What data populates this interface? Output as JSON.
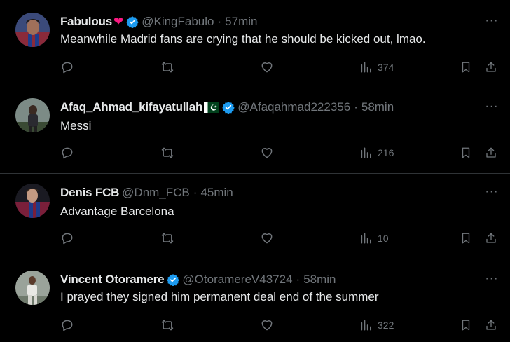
{
  "colors": {
    "background": "#000000",
    "text": "#e7e9ea",
    "muted": "#71767b",
    "verified": "#1d9bf0",
    "divider": "#2f3336"
  },
  "tweets": [
    {
      "name": "Fabulous",
      "name_suffix_icon": "red-heart-icon",
      "verified": true,
      "handle": "@KingFabulo",
      "time": "57min",
      "text": "Meanwhile Madrid fans are crying that he should be kicked out, lmao.",
      "views": "374"
    },
    {
      "name": "Afaq_Ahmad_kifayatullah",
      "name_suffix_icon": "pakistan-flag-icon",
      "verified": true,
      "handle": "@Afaqahmad222356",
      "time": "58min",
      "text": "Messi",
      "views": "216"
    },
    {
      "name": "Denis FCB",
      "verified": false,
      "handle": "@Dnm_FCB",
      "time": "45min",
      "text": "Advantage Barcelona",
      "views": "10"
    },
    {
      "name": "Vincent Otoramere",
      "verified": true,
      "handle": "@OtoramereV43724",
      "time": "58min",
      "text": "I prayed they signed him permanent deal end of the summer",
      "views": "322"
    }
  ],
  "separator": "·",
  "more_label": "···",
  "icons": [
    "reply-icon",
    "retweet-icon",
    "like-icon",
    "views-icon",
    "bookmark-icon",
    "share-icon",
    "verified-badge-icon",
    "more-icon"
  ]
}
